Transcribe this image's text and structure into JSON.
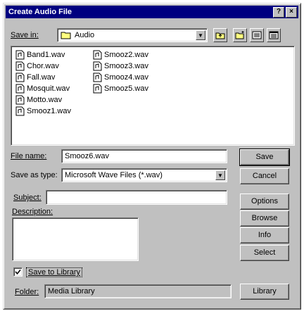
{
  "window": {
    "title": "Create Audio File"
  },
  "save_in": {
    "label": "Save in:",
    "value": "Audio"
  },
  "files": {
    "col1": [
      "Band1.wav",
      "Chor.wav",
      "Fall.wav",
      "Mosquit.wav",
      "Motto.wav",
      "Smooz1.wav"
    ],
    "col2": [
      "Smooz2.wav",
      "Smooz3.wav",
      "Smooz4.wav",
      "Smooz5.wav"
    ]
  },
  "file_name": {
    "label": "File name:",
    "value": "Smooz6.wav"
  },
  "save_as_type": {
    "label": "Save as type:",
    "value": "Microsoft Wave Files (*.wav)"
  },
  "subject": {
    "label": "Subject:",
    "value": ""
  },
  "description": {
    "label": "Description:",
    "value": ""
  },
  "save_to_library": {
    "label": "Save to Library",
    "checked": true
  },
  "folder": {
    "label": "Folder:",
    "value": "Media Library"
  },
  "buttons": {
    "save": "Save",
    "cancel": "Cancel",
    "options": "Options",
    "browse": "Browse",
    "info": "Info",
    "select": "Select",
    "library": "Library"
  }
}
